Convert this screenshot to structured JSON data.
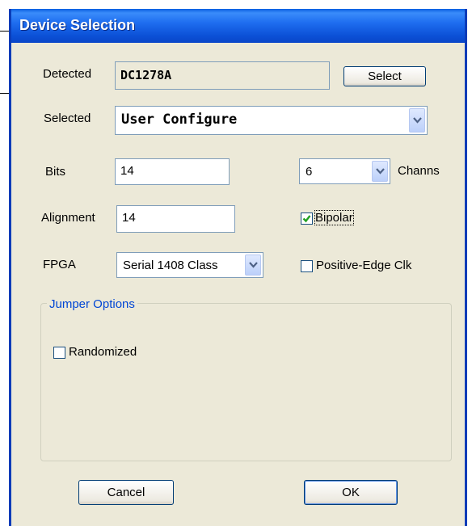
{
  "window": {
    "title": "Device Selection"
  },
  "detected": {
    "label": "Detected",
    "value": "DC1278A",
    "button": "Select"
  },
  "selected": {
    "label": "Selected",
    "value": "User Configure"
  },
  "bits": {
    "label": "Bits",
    "value": "14"
  },
  "channels": {
    "value": "6",
    "label": "Channs"
  },
  "alignment": {
    "label": "Alignment",
    "value": "14"
  },
  "bipolar": {
    "label": "Bipolar",
    "checked": true
  },
  "fpga": {
    "label": "FPGA",
    "value": "Serial 1408 Class"
  },
  "positive_edge": {
    "label": "Positive-Edge Clk",
    "checked": false
  },
  "jumper_options": {
    "legend": "Jumper Options",
    "randomized": {
      "label": "Randomized",
      "checked": false
    }
  },
  "buttons": {
    "cancel": "Cancel",
    "ok": "OK"
  },
  "colors": {
    "titlebar": "#0b50d6",
    "dialog_bg": "#ece9d8",
    "check": "#21a121",
    "group_legend": "#0046d5"
  }
}
